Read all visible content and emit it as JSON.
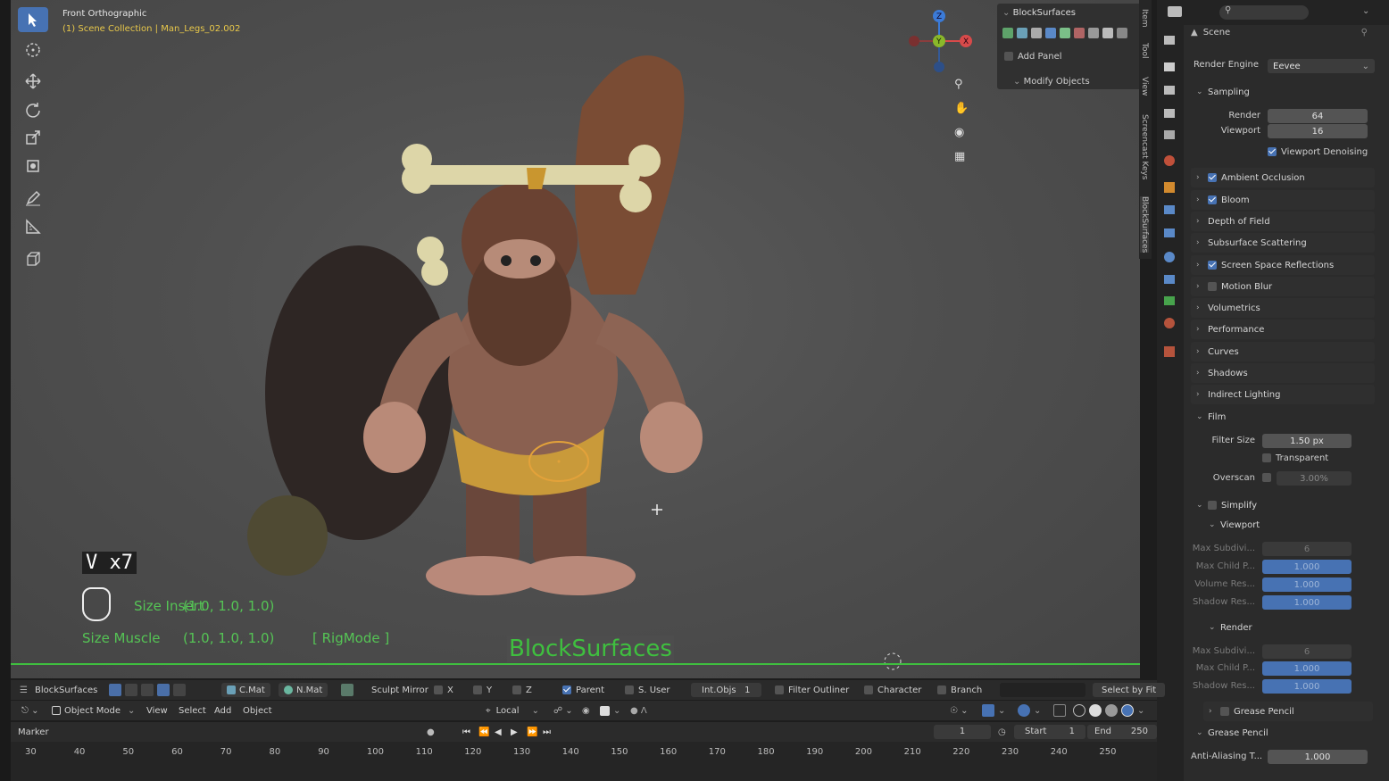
{
  "viewport": {
    "view_name": "Front Orthographic",
    "collection_path": "(1) Scene Collection | Man_Legs_02.002",
    "key_overlay": "V x7",
    "hud_line1_label": "Size Insert",
    "hud_line1_value": "(1.0, 1.0, 1.0)",
    "hud_line2_label": "Size Muscle",
    "hud_line2_value": "(1.0, 1.0, 1.0)",
    "hud_mode": "[ RigMode ]",
    "addon_title": "BlockSurfaces"
  },
  "tools": [
    {
      "name": "select-box-tool",
      "icon": "cursor-arrow-icon"
    },
    {
      "name": "cursor-tool",
      "icon": "crosshair-circle-icon"
    },
    {
      "name": "move-tool",
      "icon": "move-arrows-icon"
    },
    {
      "name": "rotate-tool",
      "icon": "rotate-icon"
    },
    {
      "name": "scale-tool",
      "icon": "scale-icon"
    },
    {
      "name": "transform-tool",
      "icon": "transform-icon"
    },
    {
      "name": "annotate-tool",
      "icon": "pencil-icon"
    },
    {
      "name": "measure-tool",
      "icon": "ruler-icon"
    },
    {
      "name": "add-cube-tool",
      "icon": "cube-add-icon"
    }
  ],
  "n_panel": {
    "title": "BlockSurfaces",
    "add_panel": "Add Panel",
    "modify_objects": "Modify Objects"
  },
  "n_tabs": [
    "Item",
    "Tool",
    "View",
    "Screencast Keys",
    "BlockSurfaces"
  ],
  "properties": {
    "scene_label": "Scene",
    "render_engine_label": "Render Engine",
    "render_engine_value": "Eevee",
    "sampling": "Sampling",
    "render_label": "Render",
    "render_value": "64",
    "viewport_label": "Viewport",
    "viewport_value": "16",
    "viewport_denoising": "Viewport Denoising",
    "sections": [
      {
        "label": "Ambient Occlusion",
        "checked": true
      },
      {
        "label": "Bloom",
        "checked": true
      },
      {
        "label": "Depth of Field"
      },
      {
        "label": "Subsurface Scattering"
      },
      {
        "label": "Screen Space Reflections",
        "checked": true
      },
      {
        "label": "Motion Blur",
        "checked": false
      },
      {
        "label": "Volumetrics"
      },
      {
        "label": "Performance"
      },
      {
        "label": "Curves"
      },
      {
        "label": "Shadows"
      },
      {
        "label": "Indirect Lighting"
      }
    ],
    "film": "Film",
    "filter_size_label": "Filter Size",
    "filter_size_value": "1.50 px",
    "transparent": "Transparent",
    "overscan_label": "Overscan",
    "overscan_value": "3.00%",
    "simplify": "Simplify",
    "simplify_viewport": "Viewport",
    "max_subdiv_label": "Max Subdivi...",
    "max_subdiv_value": "6",
    "max_child_label": "Max Child P...",
    "max_child_value": "1.000",
    "volume_res_label": "Volume Res...",
    "volume_res_value": "1.000",
    "shadow_res_label": "Shadow Res...",
    "shadow_res_value": "1.000",
    "simplify_render": "Render",
    "r_max_subdiv_label": "Max Subdivi...",
    "r_max_subdiv_value": "6",
    "r_max_child_label": "Max Child P...",
    "r_max_child_value": "1.000",
    "r_shadow_res_label": "Shadow Res...",
    "r_shadow_res_value": "1.000",
    "grease_pencil_sub": "Grease Pencil",
    "grease_pencil": "Grease Pencil",
    "anti_aliasing_label": "Anti-Aliasing T...",
    "anti_aliasing_value": "1.000"
  },
  "addon_bar": {
    "name": "BlockSurfaces",
    "c_mat": "C.Mat",
    "n_mat": "N.Mat",
    "sculpt_mirror": "Sculpt Mirror",
    "x": "X",
    "y": "Y",
    "z": "Z",
    "parent": "Parent",
    "s_user": "S. User",
    "int_objs": "Int.Objs",
    "int_objs_value": "1",
    "filter_outliner": "Filter Outliner",
    "character": "Character",
    "branch": "Branch",
    "select_by_fit": "Select by Fit"
  },
  "header": {
    "mode": "Object Mode",
    "view": "View",
    "select": "Select",
    "add": "Add",
    "object": "Object",
    "orientation": "Local"
  },
  "timeline": {
    "marker": "Marker",
    "current_frame": "1",
    "start_label": "Start",
    "start_value": "1",
    "end_label": "End",
    "end_value": "250",
    "ticks": [
      "30",
      "40",
      "50",
      "60",
      "70",
      "80",
      "90",
      "100",
      "110",
      "120",
      "130",
      "140",
      "150",
      "160",
      "170",
      "180",
      "190",
      "200",
      "210",
      "220",
      "230",
      "240",
      "250"
    ]
  },
  "colors": {
    "accent": "#4772b3",
    "hud_green": "#55c455",
    "title_green": "#3fbf3f",
    "collection_yellow": "#e8c84a"
  }
}
